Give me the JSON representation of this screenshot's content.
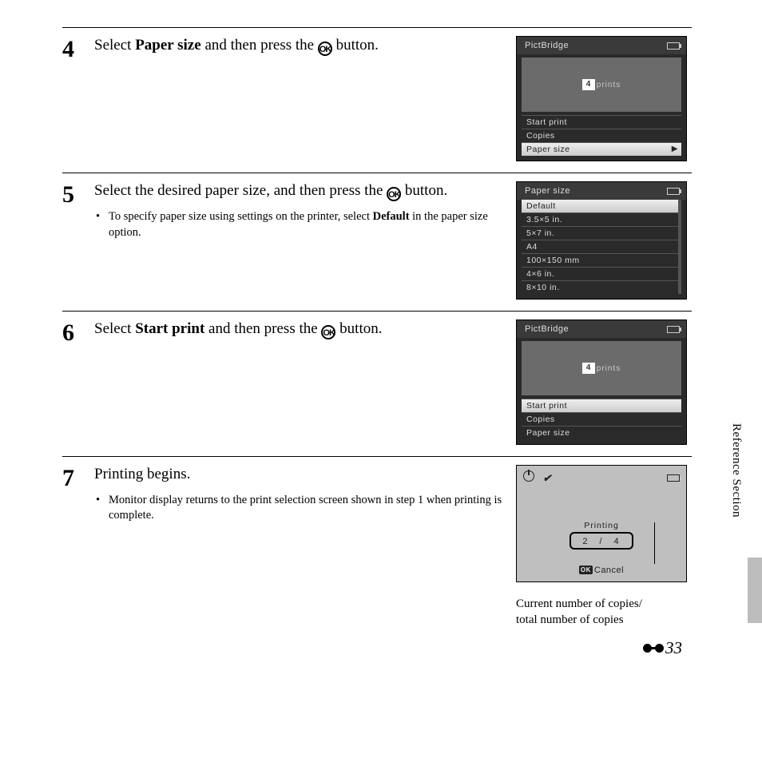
{
  "side_label": "Reference Section",
  "page_number": "33",
  "steps": {
    "s4": {
      "num": "4",
      "title_pre": "Select ",
      "title_bold": "Paper size",
      "title_post": " and then press the ",
      "title_end": " button.",
      "ok": "OK",
      "lcd": {
        "header": "PictBridge",
        "thumb": "4",
        "prints": "prints",
        "menu": [
          "Start print",
          "Copies",
          "Paper size"
        ],
        "selected": 2
      }
    },
    "s5": {
      "num": "5",
      "title_pre": "Select the desired paper size, and then press the ",
      "title_end": " button.",
      "ok": "OK",
      "bullet_pre": "To specify paper size using settings on the printer, select ",
      "bullet_bold": "Default",
      "bullet_post": " in the paper size option.",
      "lcd": {
        "header": "Paper size",
        "items": [
          "Default",
          "3.5×5 in.",
          "5×7 in.",
          "A4",
          "100×150 mm",
          "4×6 in.",
          "8×10 in."
        ],
        "selected": 0
      }
    },
    "s6": {
      "num": "6",
      "title_pre": "Select ",
      "title_bold": "Start print",
      "title_post": " and then press the ",
      "title_end": " button.",
      "ok": "OK",
      "lcd": {
        "header": "PictBridge",
        "thumb": "4",
        "prints": "prints",
        "menu": [
          "Start print",
          "Copies",
          "Paper size"
        ],
        "selected": 0
      }
    },
    "s7": {
      "num": "7",
      "title": "Printing begins.",
      "bullet": "Monitor display returns to the print selection screen shown in step 1 when printing is complete.",
      "lcd": {
        "printing_label": "Printing",
        "progress": "2　/　4",
        "cancel": "Cancel",
        "ok": "OK"
      },
      "callout": "Current number of copies/\ntotal number of copies"
    }
  }
}
